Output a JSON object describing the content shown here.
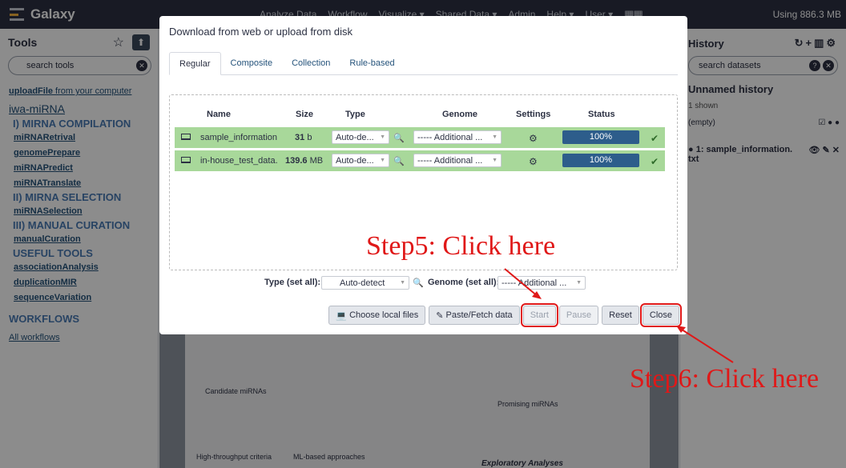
{
  "app": {
    "brand": "Galaxy",
    "usage": "Using 886.3 MB"
  },
  "nav": [
    "Analyze Data",
    "Workflow",
    "Visualize ▾",
    "Shared Data ▾",
    "Admin",
    "Help ▾",
    "User ▾"
  ],
  "tools": {
    "title": "Tools",
    "search_placeholder": "search tools",
    "upload_bold": "uploadFile",
    "upload_rest": " from your computer",
    "section": "iwa-miRNA",
    "items": [
      {
        "kind": "cat",
        "label": "I) MIRNA COMPILATION"
      },
      {
        "kind": "tool",
        "label": "miRNARetrival"
      },
      {
        "kind": "tool",
        "label": "genomePrepare"
      },
      {
        "kind": "tool",
        "label": "miRNAPredict"
      },
      {
        "kind": "tool",
        "label": "miRNATranslate"
      },
      {
        "kind": "cat",
        "label": "II) MIRNA SELECTION"
      },
      {
        "kind": "tool",
        "label": "miRNASelection"
      },
      {
        "kind": "cat",
        "label": "III) MANUAL CURATION"
      },
      {
        "kind": "tool",
        "label": "manualCuration"
      },
      {
        "kind": "cat",
        "label": "USEFUL TOOLS"
      },
      {
        "kind": "tool",
        "label": "associationAnalysis"
      },
      {
        "kind": "tool",
        "label": "duplicationMIR"
      },
      {
        "kind": "tool",
        "label": "sequenceVariation"
      }
    ],
    "workflows_heading": "WORKFLOWS",
    "all_workflows": "All workflows"
  },
  "history": {
    "title": "History",
    "search_placeholder": "search datasets",
    "name": "Unnamed history",
    "shown": "1 shown",
    "empty": "(empty)",
    "item": "1: sample_information.",
    "item2": "txt"
  },
  "modal": {
    "title": "Download from web or upload from disk",
    "tabs": [
      "Regular",
      "Composite",
      "Collection",
      "Rule-based"
    ],
    "headers": {
      "name": "Name",
      "size": "Size",
      "type": "Type",
      "genome": "Genome",
      "settings": "Settings",
      "status": "Status"
    },
    "rows": [
      {
        "name": "sample_information",
        "size_num": "31",
        "size_unit": "b",
        "type": "Auto-de...",
        "genome": "----- Additional ...",
        "progress": "100%",
        "progress_value": 100
      },
      {
        "name": "in-house_test_data.",
        "size_num": "139.6",
        "size_unit": "MB",
        "type": "Auto-de...",
        "genome": "----- Additional ...",
        "progress": "100%",
        "progress_value": 100
      }
    ],
    "type_set_all_label": "Type (set all):",
    "type_set_all_value": "Auto-detect",
    "genome_set_all_label": "Genome (set all):",
    "genome_set_all_value": "----- Additional ...",
    "buttons": {
      "choose": "Choose local files",
      "paste": "Paste/Fetch data",
      "start": "Start",
      "pause": "Pause",
      "reset": "Reset",
      "close": "Close"
    }
  },
  "annotations": {
    "step5": "Step5: Click here",
    "step6": "Step6: Click here"
  },
  "background": {
    "label1": "Candidate miRNAs",
    "label2": "Promising miRNAs",
    "label3": "High-throughput criteria",
    "label4": "ML-based approaches",
    "label5": "Exploratory Analyses"
  },
  "colors": {
    "topbar": "#2c3143",
    "accent": "#25537b",
    "row_ok": "#a8d89a",
    "progress": "#2d5d8b",
    "annotation": "#e01818"
  }
}
